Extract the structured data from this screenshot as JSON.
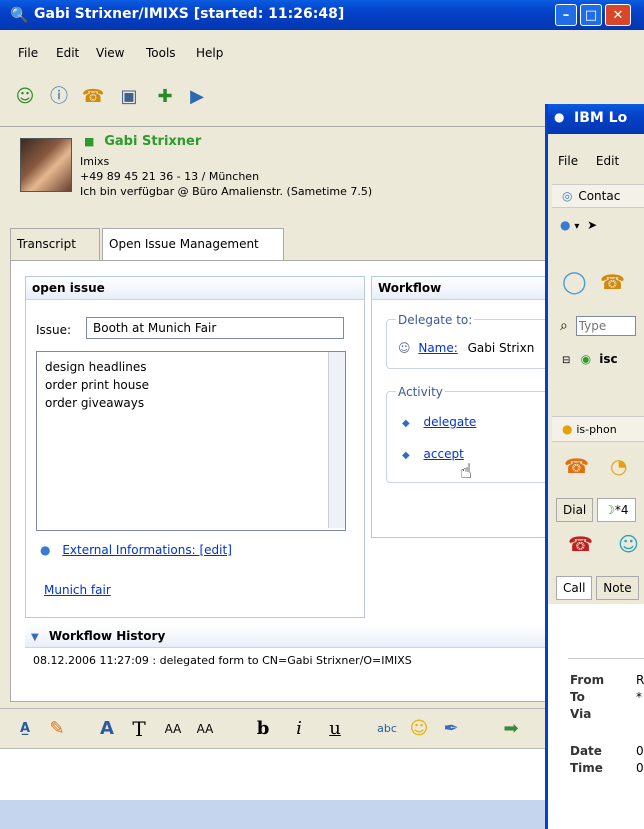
{
  "main_window": {
    "title": "Gabi Strixner/IMIXS [started: 11:26:48]",
    "menu": [
      "File",
      "Edit",
      "View",
      "Tools",
      "Help"
    ],
    "toolbar_icons": [
      "contacts-icon",
      "help-icon",
      "call-icon",
      "meeting-icon",
      "add-contact-icon",
      "chat-history-icon"
    ],
    "contact": {
      "name": "Gabi Strixner",
      "company": "Imixs",
      "phone": "+49 89 45 21 36  - 13 / München",
      "status": "Ich bin verfügbar @ Büro Amalienstr. (Sametime 7.5)"
    },
    "tabs": [
      "Transcript",
      "Open Issue Management"
    ],
    "open_issue": {
      "header": "open issue",
      "issue_label": "Issue:",
      "issue_value": "Booth at Munich Fair",
      "tasks": [
        "design headlines",
        "order print house",
        "order giveaways"
      ],
      "external_info": "External Informations: [edit]",
      "link": "Munich fair"
    },
    "workflow": {
      "header": "Workflow",
      "delegate_label": "Delegate to:",
      "name_label": "Name:",
      "name_value": "Gabi Strixn",
      "activity_label": "Activity",
      "actions": [
        "delegate",
        "accept"
      ]
    },
    "history": {
      "header": "Workflow History",
      "entry": "08.12.2006 11:27:09 : delegated form  to CN=Gabi Strixner/O=IMIXS"
    },
    "format_toolbar": [
      "emoticon-text-icon",
      "pen-icon",
      "font-color-icon",
      "font-icon",
      "shrink-font-icon",
      "grow-font-icon",
      "bold-icon",
      "italic-icon",
      "underline-icon",
      "spellcheck-icon",
      "smiley-icon",
      "link-icon",
      "send-file-icon"
    ]
  },
  "lotus_window": {
    "title": "IBM Lo",
    "menu": [
      "File",
      "Edit"
    ],
    "contacts_tab": "Contac",
    "search_placeholder": "Type",
    "group": "isc",
    "phone_tab": "is-phon",
    "tabs": [
      "Dial",
      "*4"
    ],
    "subtabs": [
      "Call",
      "Note"
    ],
    "fields": [
      {
        "label": "From",
        "value": "R"
      },
      {
        "label": "To",
        "value": "*"
      },
      {
        "label": "Via",
        "value": ""
      },
      {
        "label": "Date",
        "value": "0"
      },
      {
        "label": "Time",
        "value": "0"
      }
    ]
  },
  "colors": {
    "titlebar": "#0441c8",
    "link": "#0033cc",
    "status_green": "#2e9a2e"
  }
}
